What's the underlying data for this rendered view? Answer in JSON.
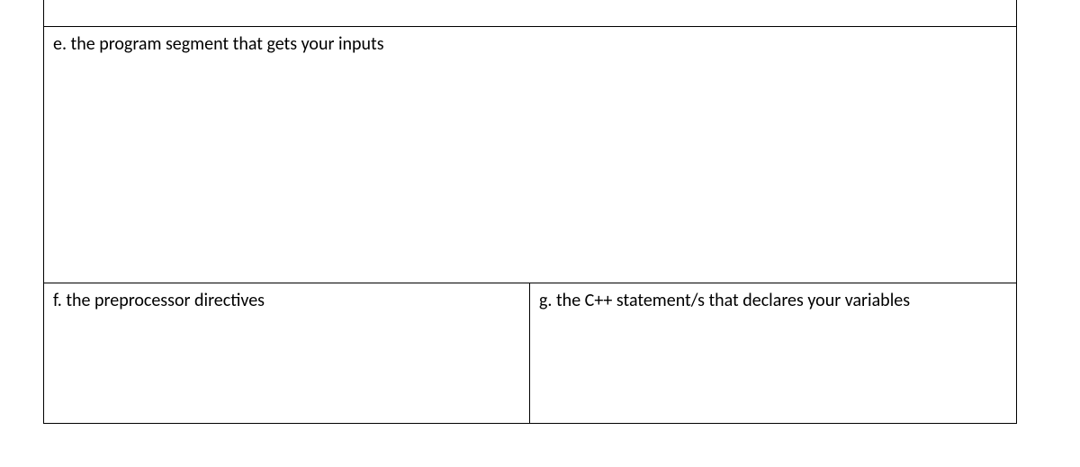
{
  "cells": {
    "e": "e. the program segment that gets your inputs",
    "f": "f. the preprocessor directives",
    "g": "g. the C++ statement/s that declares your variables"
  }
}
